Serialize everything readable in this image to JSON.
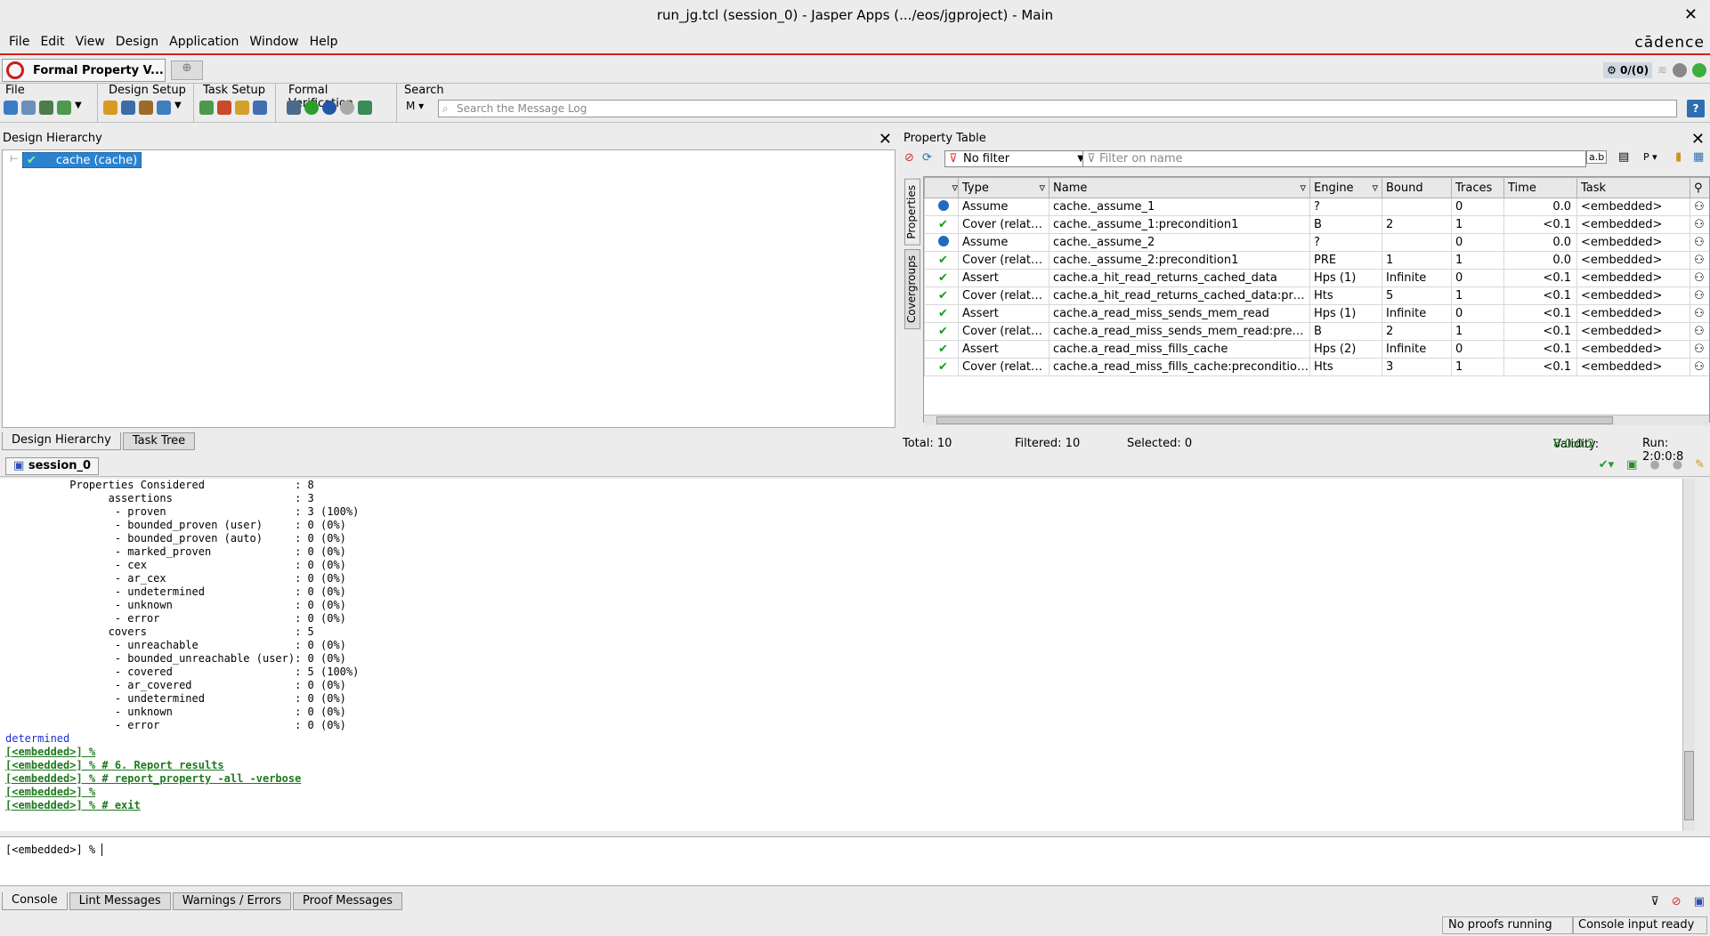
{
  "window": {
    "title": "run_jg.tcl (session_0) - Jasper Apps (.../eos/jgproject) - Main",
    "close": "✕"
  },
  "menu": {
    "items": [
      "File",
      "Edit",
      "View",
      "Design",
      "Application",
      "Window",
      "Help"
    ],
    "brand": "cādence"
  },
  "appbar": {
    "app_tab": "Formal Property V...",
    "counter": "0/(0)"
  },
  "toolbar": {
    "groups": [
      "File",
      "Design Setup",
      "Task Setup",
      "Formal Verification",
      "Search"
    ],
    "search_mode": "M",
    "search_placeholder": "Search the Message Log",
    "help": "?"
  },
  "design_hierarchy": {
    "title": "Design Hierarchy",
    "node": "cache (cache)",
    "tabs": [
      "Design Hierarchy",
      "Task Tree"
    ]
  },
  "property_table": {
    "title": "Property Table",
    "filter_value": "No filter",
    "filter_name_placeholder": "Filter on name",
    "side_tabs": [
      "Properties",
      "Covergroups"
    ],
    "columns": [
      "Type",
      "Name",
      "Engine",
      "Bound",
      "Traces",
      "Time",
      "Task"
    ],
    "rows": [
      {
        "status": "blue",
        "type": "Assume",
        "name": "cache._assume_1",
        "engine": "?",
        "bound": "",
        "traces": "0",
        "time": "0.0",
        "task": "<embedded>"
      },
      {
        "status": "check",
        "type": "Cover (related)",
        "name": "cache._assume_1:precondition1",
        "engine": "B",
        "bound": "2",
        "traces": "1",
        "time": "<0.1",
        "task": "<embedded>"
      },
      {
        "status": "blue",
        "type": "Assume",
        "name": "cache._assume_2",
        "engine": "?",
        "bound": "",
        "traces": "0",
        "time": "0.0",
        "task": "<embedded>"
      },
      {
        "status": "check",
        "type": "Cover (related)",
        "name": "cache._assume_2:precondition1",
        "engine": "PRE",
        "bound": "1",
        "traces": "1",
        "time": "0.0",
        "task": "<embedded>"
      },
      {
        "status": "check",
        "type": "Assert",
        "name": "cache.a_hit_read_returns_cached_data",
        "engine": "Hps (1)",
        "bound": "Infinite",
        "traces": "0",
        "time": "<0.1",
        "task": "<embedded>"
      },
      {
        "status": "check",
        "type": "Cover (related)",
        "name": "cache.a_hit_read_returns_cached_data:preco...",
        "engine": "Hts",
        "bound": "5",
        "traces": "1",
        "time": "<0.1",
        "task": "<embedded>"
      },
      {
        "status": "check",
        "type": "Assert",
        "name": "cache.a_read_miss_sends_mem_read",
        "engine": "Hps (1)",
        "bound": "Infinite",
        "traces": "0",
        "time": "<0.1",
        "task": "<embedded>"
      },
      {
        "status": "check",
        "type": "Cover (related)",
        "name": "cache.a_read_miss_sends_mem_read:precon...",
        "engine": "B",
        "bound": "2",
        "traces": "1",
        "time": "<0.1",
        "task": "<embedded>"
      },
      {
        "status": "check",
        "type": "Assert",
        "name": "cache.a_read_miss_fills_cache",
        "engine": "Hps (2)",
        "bound": "Infinite",
        "traces": "0",
        "time": "<0.1",
        "task": "<embedded>"
      },
      {
        "status": "check",
        "type": "Cover (related)",
        "name": "cache.a_read_miss_fills_cache:precondition1",
        "engine": "Hts",
        "bound": "3",
        "traces": "1",
        "time": "<0.1",
        "task": "<embedded>"
      }
    ],
    "status": {
      "total": "Total: 10",
      "filtered": "Filtered: 10",
      "selected": "Selected: 0",
      "validity_label": "Validity:",
      "validity_value": "8:0:0:2",
      "run": "Run: 2:0:0:8"
    }
  },
  "session": {
    "tab": "session_0"
  },
  "console": {
    "lines": [
      {
        "t": "          Properties Considered              : 8",
        "s": ""
      },
      {
        "t": "                assertions                   : 3",
        "s": ""
      },
      {
        "t": "                 - proven                    : 3 (100%)",
        "s": ""
      },
      {
        "t": "                 - bounded_proven (user)     : 0 (0%)",
        "s": ""
      },
      {
        "t": "                 - bounded_proven (auto)     : 0 (0%)",
        "s": ""
      },
      {
        "t": "                 - marked_proven             : 0 (0%)",
        "s": ""
      },
      {
        "t": "                 - cex                       : 0 (0%)",
        "s": ""
      },
      {
        "t": "                 - ar_cex                    : 0 (0%)",
        "s": ""
      },
      {
        "t": "                 - undetermined              : 0 (0%)",
        "s": ""
      },
      {
        "t": "                 - unknown                   : 0 (0%)",
        "s": ""
      },
      {
        "t": "                 - error                     : 0 (0%)",
        "s": ""
      },
      {
        "t": "                covers                       : 5",
        "s": ""
      },
      {
        "t": "                 - unreachable               : 0 (0%)",
        "s": ""
      },
      {
        "t": "                 - bounded_unreachable (user): 0 (0%)",
        "s": ""
      },
      {
        "t": "                 - covered                   : 5 (100%)",
        "s": ""
      },
      {
        "t": "                 - ar_covered                : 0 (0%)",
        "s": ""
      },
      {
        "t": "                 - undetermined              : 0 (0%)",
        "s": ""
      },
      {
        "t": "                 - unknown                   : 0 (0%)",
        "s": ""
      },
      {
        "t": "                 - error                     : 0 (0%)",
        "s": ""
      },
      {
        "t": "determined",
        "s": "blue"
      },
      {
        "t": "[<embedded>] %",
        "s": "green"
      },
      {
        "t": "[<embedded>] % # 6. Report results",
        "s": "green"
      },
      {
        "t": "[<embedded>] % # report_property -all -verbose",
        "s": "green"
      },
      {
        "t": "[<embedded>] %",
        "s": "green"
      },
      {
        "t": "[<embedded>] % # exit",
        "s": "green"
      }
    ],
    "prompt": "[<embedded>] %"
  },
  "console_tabs": [
    "Console",
    "Lint Messages",
    "Warnings / Errors",
    "Proof Messages"
  ],
  "statusbar": {
    "proofs": "No proofs running",
    "input": "Console input ready"
  }
}
